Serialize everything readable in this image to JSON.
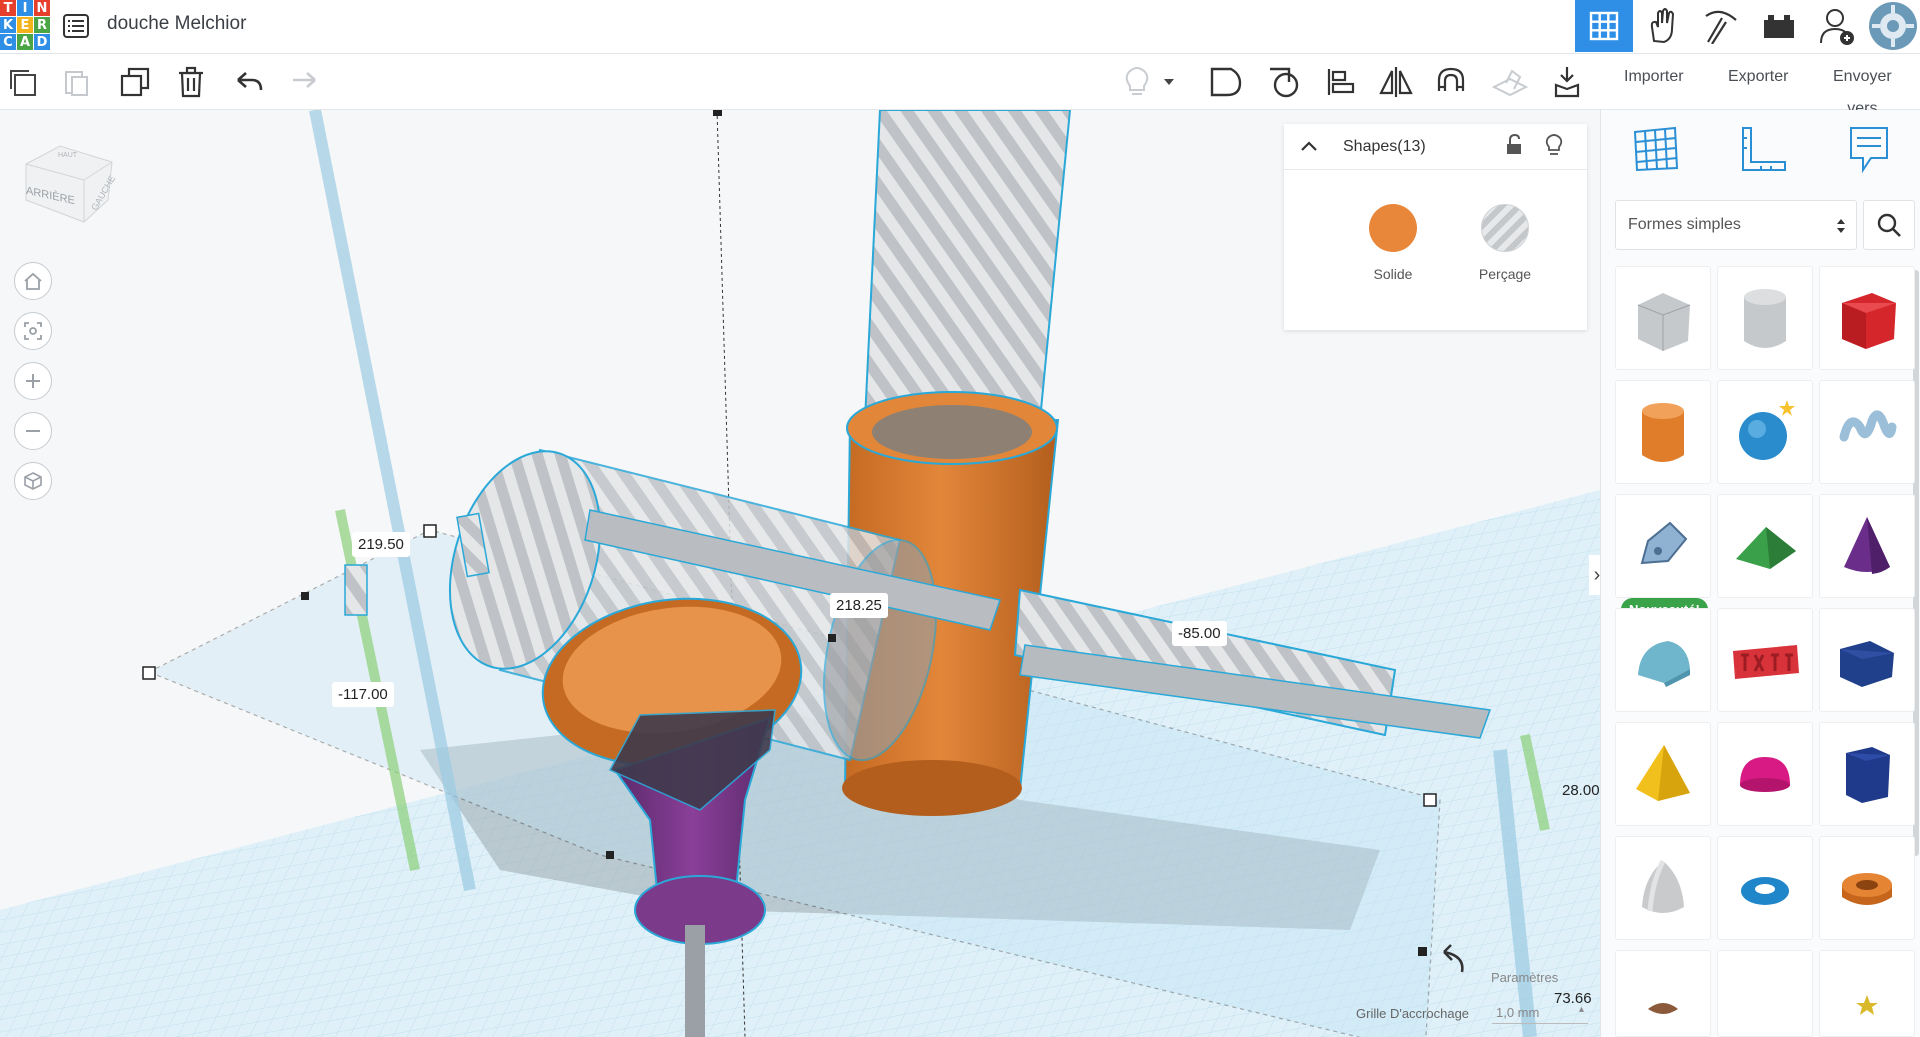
{
  "app": {
    "logo_letters": [
      "T",
      "I",
      "N",
      "K",
      "E",
      "R",
      "C",
      "A",
      "D"
    ],
    "document_title": "douche Melchior"
  },
  "toolbar": {
    "import_label": "Importer",
    "export_label": "Exporter",
    "send_label_line1": "Envoyer",
    "send_label_line2": "vers"
  },
  "viewport": {
    "view_cube_label_front": "ARRIÈRE",
    "view_cube_label_side": "GAUCHE",
    "view_cube_label_top": "HAUT",
    "dimensions": {
      "d1": "219.50",
      "d2": "218.25",
      "d3": "-85.00",
      "d4": "-117.00",
      "d5": "28.00",
      "d6": "73.66"
    },
    "settings_label": "Paramètres",
    "snap_grid_label": "Grille D'accrochage",
    "snap_grid_value": "1,0 mm"
  },
  "shapes_panel": {
    "title": "Shapes(13)",
    "solid_label": "Solide",
    "hole_label": "Perçage",
    "solid_color": "#e8873a"
  },
  "library": {
    "category": "Formes simples",
    "new_badge": "Nouveauté!"
  },
  "colors": {
    "accent": "#2f8fe6",
    "orange": "#e0822f",
    "purple": "#7b3a8a",
    "grid": "#d7eef7"
  }
}
